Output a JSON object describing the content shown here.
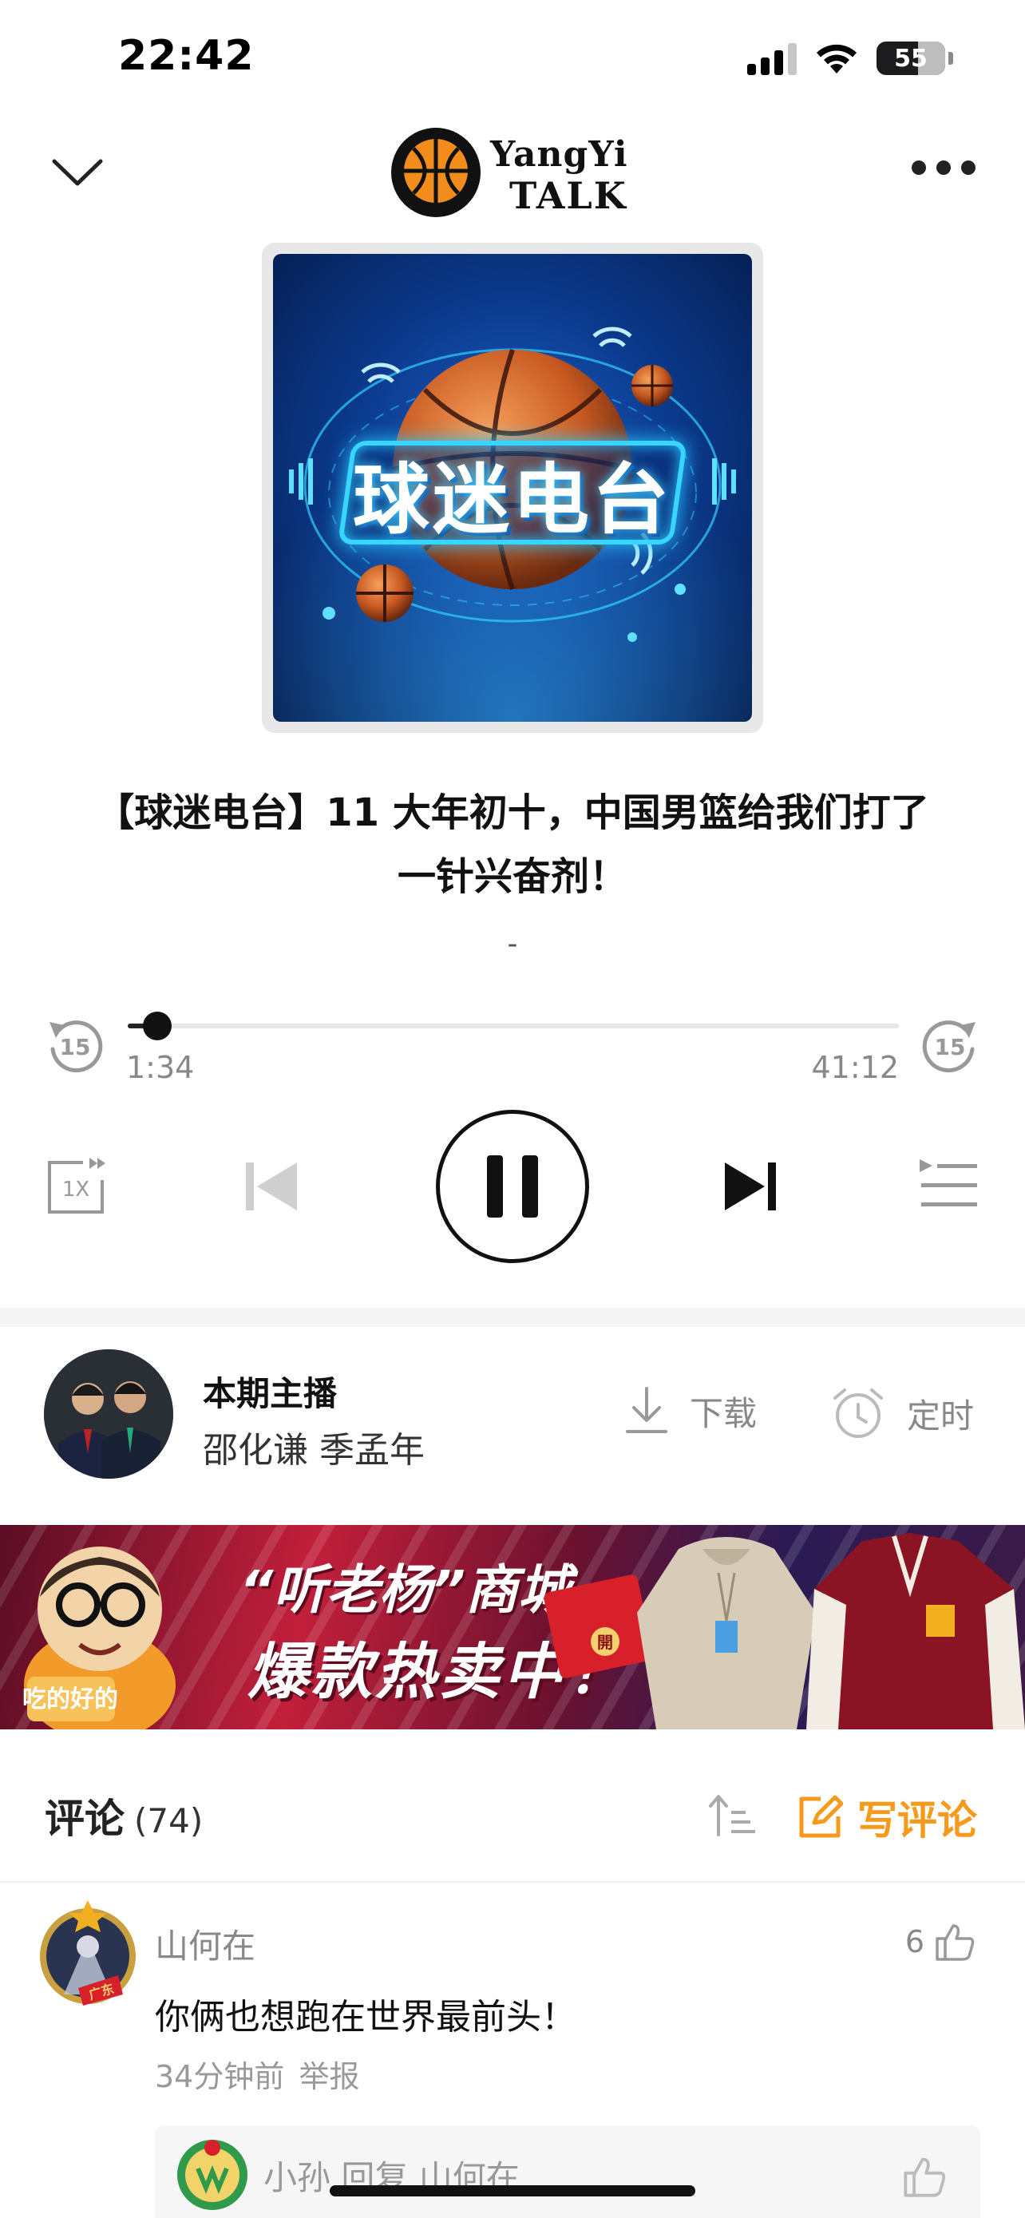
{
  "status_bar": {
    "time": "22:42",
    "battery": "55"
  },
  "header": {
    "logo_line1": "YangYi",
    "logo_line2": "TALK"
  },
  "cover": {
    "title": "球迷电台"
  },
  "episode": {
    "title_line1": "【球迷电台】11 大年初十，中国男篮给我们打了",
    "title_line2": "一针兴奋剂！",
    "subtitle": "-"
  },
  "player": {
    "current_time": "1:34",
    "total_time": "41:12",
    "progress": 0.038,
    "skip_seconds": "15",
    "speed": "1X",
    "state": "playing"
  },
  "host": {
    "label": "本期主播",
    "names": "邵化谦 季孟年",
    "download_label": "下载",
    "timer_label": "定时"
  },
  "banner": {
    "line1": "“听老杨”商城",
    "line2": "爆款热卖中！",
    "mascot_text": "吃的好的",
    "envelope_text": "開"
  },
  "comments": {
    "title": "评论",
    "count": "(74)",
    "write_label": "写评论",
    "items": [
      {
        "user": "山何在",
        "likes": "6",
        "text": "你俩也想跑在世界最前头！",
        "time": "34分钟前",
        "report": "举报",
        "badge": "广东",
        "reply": {
          "user": "小孙 回复 山何在"
        }
      }
    ]
  },
  "colors": {
    "accent": "#f59a1c",
    "text": "#222222",
    "muted": "#888888"
  }
}
